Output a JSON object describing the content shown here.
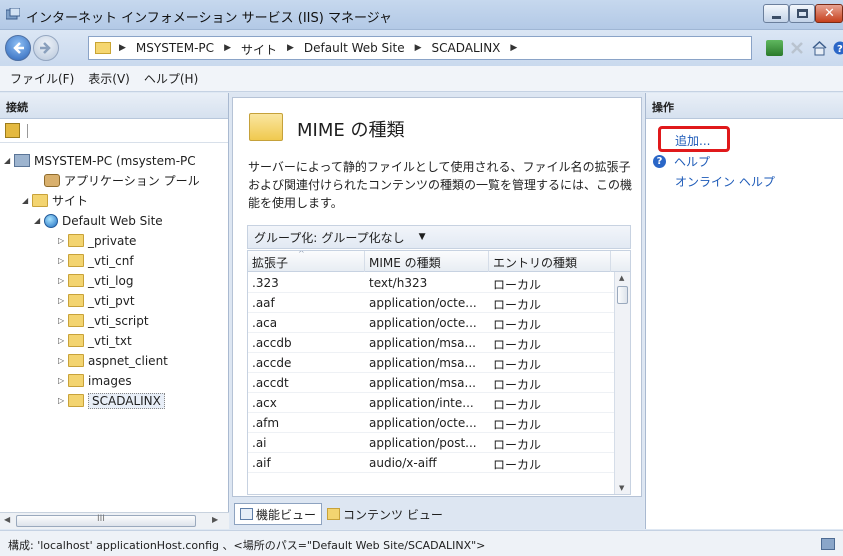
{
  "window": {
    "title": "インターネット インフォメーション サービス (IIS) マネージャ"
  },
  "address": {
    "crumbs": [
      "MSYSTEM-PC",
      "サイト",
      "Default Web Site",
      "SCADALINX"
    ],
    "separator": "▶"
  },
  "menu": {
    "items": [
      "ファイル(F)",
      "表示(V)",
      "ヘルプ(H)"
    ]
  },
  "connections": {
    "header": "接続",
    "tree": [
      {
        "label": "MSYSTEM-PC (msystem-PC",
        "expander": "◢",
        "icon": "server-icon"
      },
      {
        "label": "アプリケーション プール",
        "expander": "",
        "icon": "app-pool-icon"
      },
      {
        "label": "サイト",
        "expander": "◢",
        "icon": "sites-folder-icon"
      },
      {
        "label": "Default Web Site",
        "expander": "◢",
        "icon": "globe-icon"
      },
      {
        "label": "_private",
        "expander": "▷",
        "icon": "folder-icon"
      },
      {
        "label": "_vti_cnf",
        "expander": "▷",
        "icon": "folder-icon"
      },
      {
        "label": "_vti_log",
        "expander": "▷",
        "icon": "folder-icon"
      },
      {
        "label": "_vti_pvt",
        "expander": "▷",
        "icon": "folder-icon"
      },
      {
        "label": "_vti_script",
        "expander": "▷",
        "icon": "folder-icon"
      },
      {
        "label": "_vti_txt",
        "expander": "▷",
        "icon": "folder-icon"
      },
      {
        "label": "aspnet_client",
        "expander": "▷",
        "icon": "folder-icon"
      },
      {
        "label": "images",
        "expander": "▷",
        "icon": "folder-icon"
      },
      {
        "label": "SCADALINX",
        "expander": "▷",
        "icon": "folder-icon",
        "selected": true
      }
    ],
    "hscroll_thumb": "III"
  },
  "feature": {
    "title": "MIME の種類",
    "description": "サーバーによって静的ファイルとして使用される、ファイル名の拡張子および関連付けられたコンテンツの種類の一覧を管理するには、この機能を使用します。",
    "group_label": "グループ化:",
    "group_value": "グループ化なし",
    "columns": [
      "拡張子",
      "MIME の種類",
      "エントリの種類"
    ],
    "rows": [
      [
        ".323",
        "text/h323",
        "ローカル"
      ],
      [
        ".aaf",
        "application/octe...",
        "ローカル"
      ],
      [
        ".aca",
        "application/octe...",
        "ローカル"
      ],
      [
        ".accdb",
        "application/msa...",
        "ローカル"
      ],
      [
        ".accde",
        "application/msa...",
        "ローカル"
      ],
      [
        ".accdt",
        "application/msa...",
        "ローカル"
      ],
      [
        ".acx",
        "application/inte...",
        "ローカル"
      ],
      [
        ".afm",
        "application/octe...",
        "ローカル"
      ],
      [
        ".ai",
        "application/post...",
        "ローカル"
      ],
      [
        ".aif",
        "audio/x-aiff",
        "ローカル"
      ]
    ],
    "view_tabs": [
      "機能ビュー",
      "コンテンツ ビュー"
    ]
  },
  "actions": {
    "header": "操作",
    "add": "追加...",
    "help": "ヘルプ",
    "online_help": "オンライン ヘルプ",
    "highlight_color": "#e0191b",
    "link_color": "#1e5bb8"
  },
  "status": {
    "text": "構成: 'localhost' applicationHost.config 、<場所のパス=\"Default Web Site/SCADALINX\">"
  }
}
